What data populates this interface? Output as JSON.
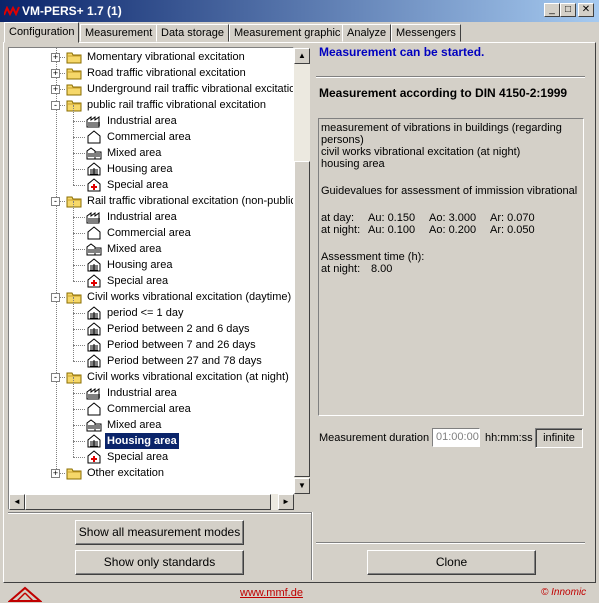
{
  "window": {
    "title": "VM-PERS+ 1.7 (1)",
    "min_glyph": "_",
    "max_glyph": "□",
    "close_glyph": "✕"
  },
  "tabs": [
    {
      "label": "Configuration",
      "active": true
    },
    {
      "label": "Measurement"
    },
    {
      "label": "Data storage"
    },
    {
      "label": "Measurement graphic"
    },
    {
      "label": "Analyze"
    },
    {
      "label": "Messengers"
    }
  ],
  "tree": {
    "items": [
      {
        "label": "Momentary vibrational excitation",
        "icon": "folder-icon",
        "level": 0,
        "expander": "+"
      },
      {
        "label": "Road traffic vibrational excitation",
        "icon": "folder-icon",
        "level": 0,
        "expander": "+"
      },
      {
        "label": "Underground rail traffic vibrational excitation",
        "icon": "folder-icon",
        "level": 0,
        "expander": "+"
      },
      {
        "label": "public rail traffic vibrational excitation",
        "icon": "folder-icon",
        "level": 0,
        "expander": "-"
      },
      {
        "label": "Industrial area",
        "icon": "factory-icon",
        "level": 1
      },
      {
        "label": "Commercial area",
        "icon": "house-outline-icon",
        "level": 1
      },
      {
        "label": "Mixed area",
        "icon": "mixed-building-icon",
        "level": 1
      },
      {
        "label": "Housing area",
        "icon": "house-icon",
        "level": 1
      },
      {
        "label": "Special area",
        "icon": "hospital-icon",
        "level": 1
      },
      {
        "label": "Rail traffic vibrational excitation (non-public)",
        "icon": "folder-icon",
        "level": 0,
        "expander": "-"
      },
      {
        "label": "Industrial area",
        "icon": "factory-icon",
        "level": 1
      },
      {
        "label": "Commercial area",
        "icon": "house-outline-icon",
        "level": 1
      },
      {
        "label": "Mixed area",
        "icon": "mixed-building-icon",
        "level": 1
      },
      {
        "label": "Housing area",
        "icon": "house-icon",
        "level": 1
      },
      {
        "label": "Special area",
        "icon": "hospital-icon",
        "level": 1
      },
      {
        "label": "Civil works vibrational excitation (daytime)",
        "icon": "folder-icon",
        "level": 0,
        "expander": "-"
      },
      {
        "label": "period <= 1 day",
        "icon": "house-icon",
        "level": 1
      },
      {
        "label": "Period between 2 and 6 days",
        "icon": "house-icon",
        "level": 1
      },
      {
        "label": "Period between 7 and 26 days",
        "icon": "house-icon",
        "level": 1
      },
      {
        "label": "Period between 27 and 78 days",
        "icon": "house-icon",
        "level": 1
      },
      {
        "label": "Civil works vibrational excitation (at night)",
        "icon": "folder-icon",
        "level": 0,
        "expander": "-"
      },
      {
        "label": "Industrial area",
        "icon": "factory-icon",
        "level": 1
      },
      {
        "label": "Commercial area",
        "icon": "house-outline-icon",
        "level": 1
      },
      {
        "label": "Mixed area",
        "icon": "mixed-building-icon",
        "level": 1
      },
      {
        "label": "Housing area",
        "icon": "house-icon",
        "level": 1,
        "selected": true
      },
      {
        "label": "Special area",
        "icon": "hospital-icon",
        "level": 1
      },
      {
        "label": "Other excitation",
        "icon": "folder-icon",
        "level": 0,
        "expander": "+"
      }
    ]
  },
  "buttons": {
    "show_all": "Show all measurement modes",
    "show_standards": "Show only standards",
    "clone": "Clone"
  },
  "right": {
    "status": "Measurement can be started.",
    "heading": "Measurement according to DIN 4150-2:1999",
    "info": {
      "line1": "measurement of vibrations in buildings (regarding",
      "line2": "persons)",
      "line3": "civil works vibrational excitation (at night)",
      "line4": "housing area",
      "guide": "Guidevalues for assessment of immission vibrational",
      "rows": [
        {
          "label": "at day:",
          "au": "Au: 0.150",
          "ao": "Ao: 3.000",
          "ar": "Ar: 0.070"
        },
        {
          "label": "at night:",
          "au": "Au: 0.100",
          "ao": "Ao: 0.200",
          "ar": "Ar: 0.050"
        }
      ],
      "assess_label": "Assessment time (h):",
      "assess_night": "at night:",
      "assess_value": "8.00"
    },
    "duration_label": "Measurement duration",
    "duration_value": "01:00:00",
    "duration_unit": "hh:mm:ss",
    "infinite_label": "infinite"
  },
  "footer": {
    "link": "www.mmf.de",
    "copyright": "© Innomic"
  }
}
